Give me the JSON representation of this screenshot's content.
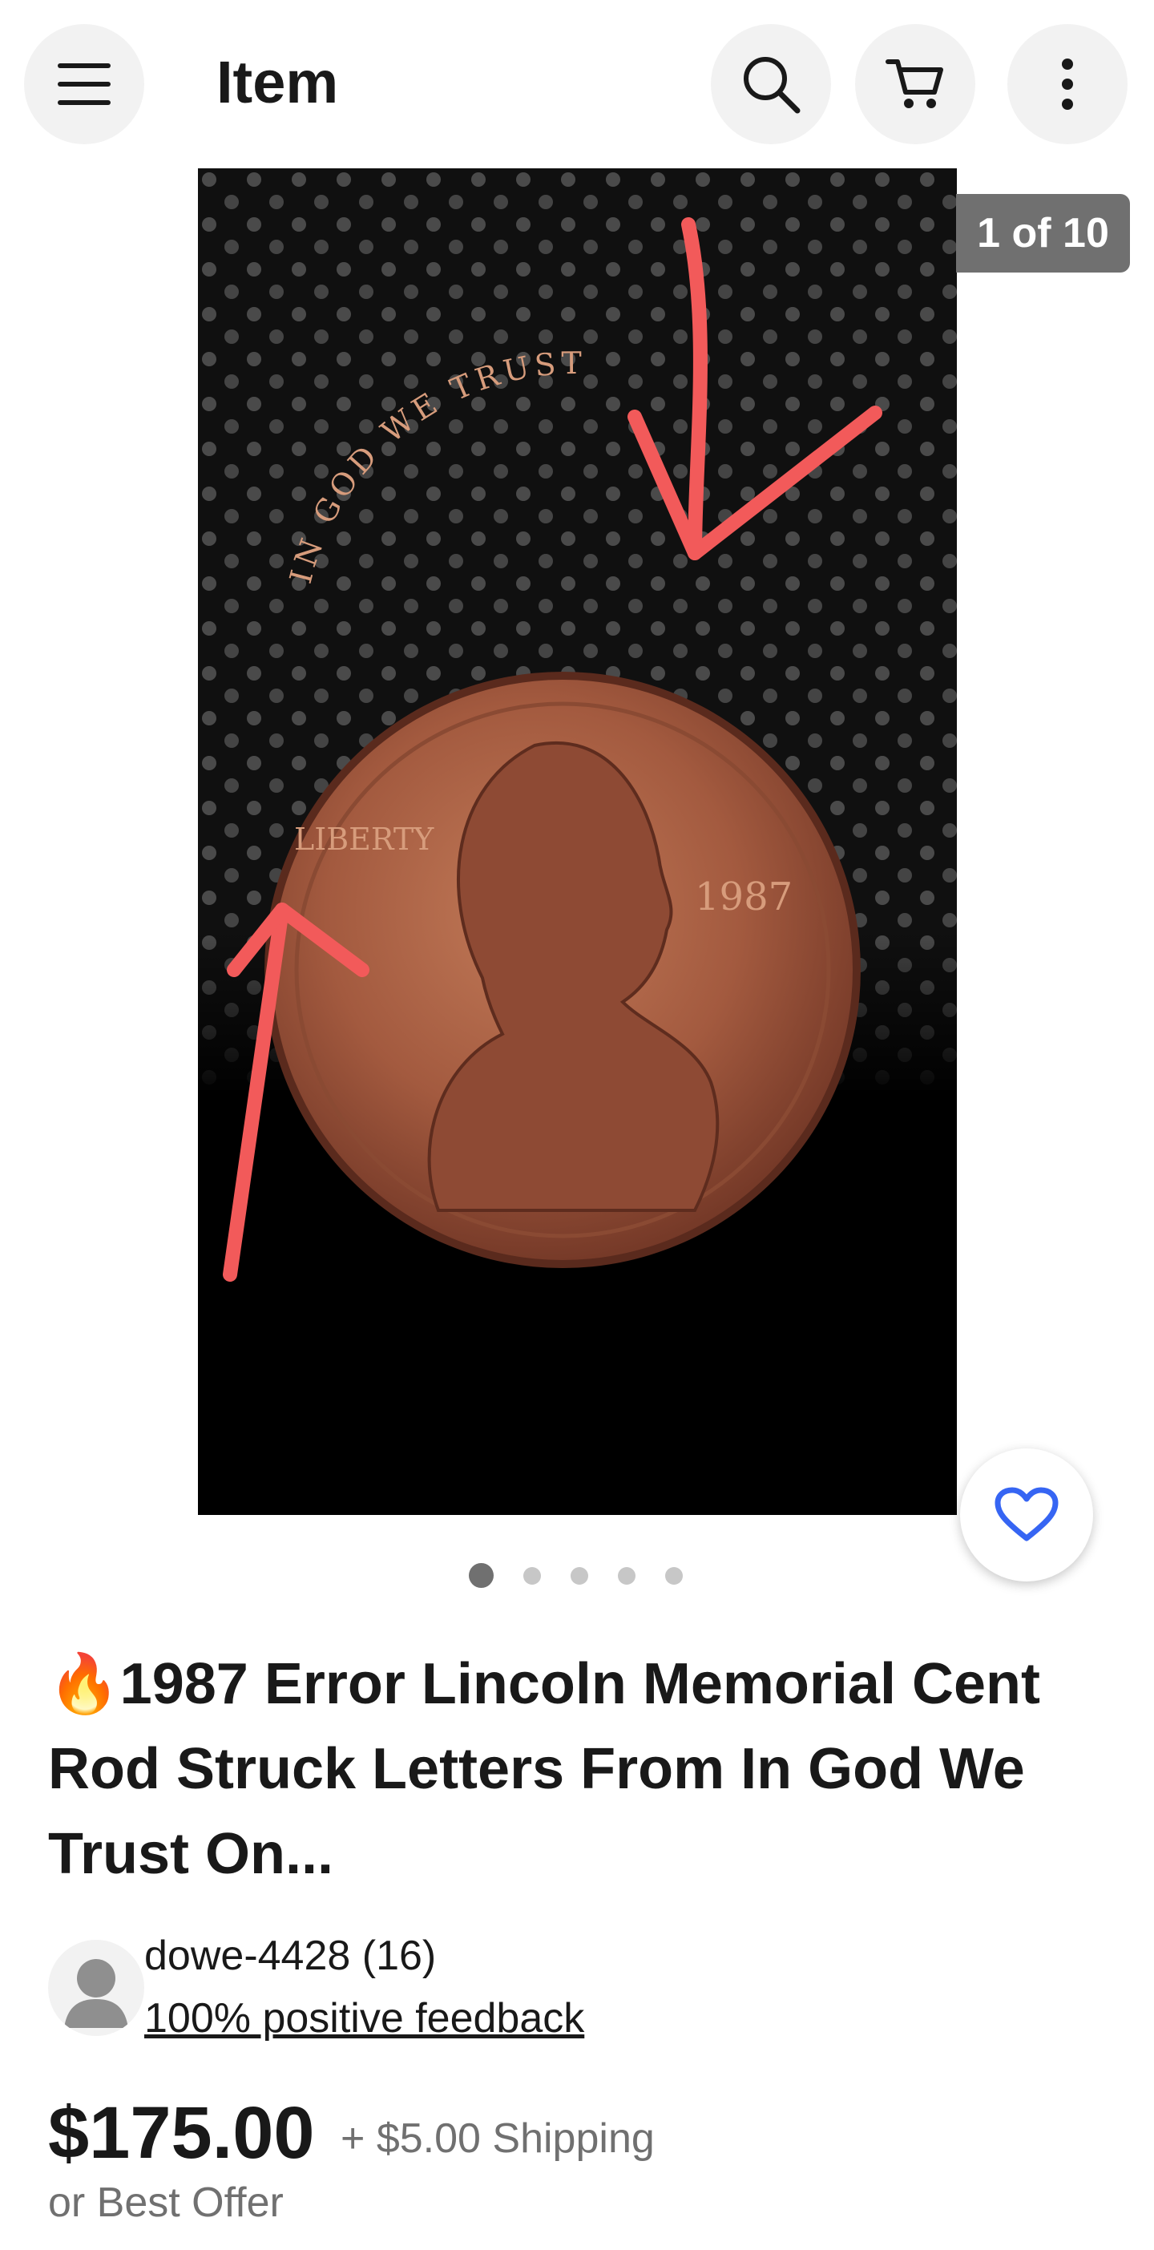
{
  "header": {
    "title": "Item",
    "icons": [
      "menu-icon",
      "search-icon",
      "cart-icon",
      "more-icon"
    ]
  },
  "gallery": {
    "counter": "1 of 10",
    "dots": 5,
    "active_dot": 0,
    "coin_text": {
      "motto": "IN GOD WE TRUST",
      "liberty": "LIBERTY",
      "year": "1987"
    },
    "annotation_color": "#f25a5a"
  },
  "listing": {
    "flame": "🔥",
    "title": "1987 Error Lincoln Memorial Cent Rod Struck Letters From In God We Trust On...",
    "seller": {
      "name": "dowe-4428 (16)",
      "feedback": "100% positive feedback"
    },
    "price": "$175.00",
    "shipping": "+ $5.00 Shipping",
    "offer": "or Best Offer"
  },
  "colors": {
    "text": "#191919",
    "secondary_text": "#707070",
    "button_bg": "#f2f2f2",
    "heart": "#3665f3"
  }
}
